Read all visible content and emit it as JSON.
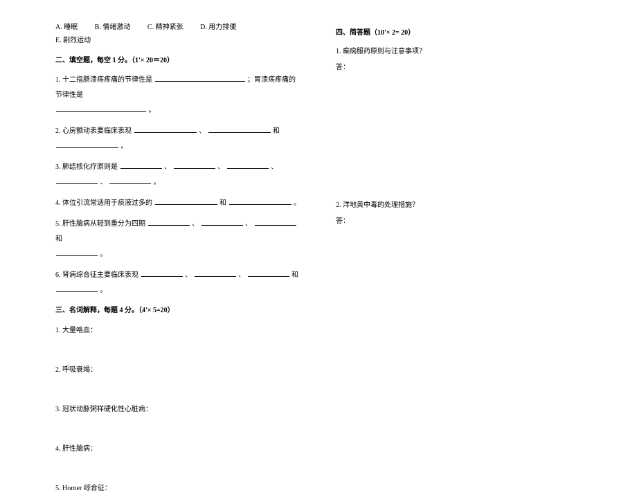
{
  "leftColumn": {
    "options": {
      "a": "A. 睡眠",
      "b": "B. 情绪激动",
      "c": "C. 精神紧张",
      "d": "D. 用力排便",
      "e": "E. 剧烈运动"
    },
    "secHeading2": "二、填空题，每空 1 分。（1'× 20＝20）",
    "fill": {
      "q1_pre": "1. 十二指肠溃疡疼痛的节律性是",
      "q1_mid": "；胃溃疡疼痛的节律性是",
      "q1_end": "。",
      "q2_pre": "2. 心房颤动表要临床表现",
      "q2_sep1": "、",
      "q2_sep2": "和",
      "q2_end": "。",
      "q3_pre": "3. 肺结核化疗原则是",
      "q3_sep": "、",
      "q3_end": "。",
      "q4_pre": "4. 体位引流常适用于痰液过多的",
      "q4_sep": "和",
      "q4_end": "。",
      "q5_pre": "5. 肝性脑病从轻到重分为四期",
      "q5_sep": "、",
      "q5_sep_and": "和",
      "q5_end": "。",
      "q6_pre": "6. 肾病综合征主要临床表现",
      "q6_sep": "、",
      "q6_sep_and": "和",
      "q6_end": "。"
    },
    "secHeading3": "三、名词解释，每题 4 分。（4'× 5=20）",
    "terms": {
      "t1": "1. 大量咯血：",
      "t2": "2. 呼吸衰竭：",
      "t3": "3. 冠状动脉粥样硬化性心脏病：",
      "t4": "4. 肝性脑病：",
      "t5": "5. Horner 综合征："
    }
  },
  "rightColumn": {
    "secHeading4": "四、简答题（10'× 2= 20）",
    "q1": "1. 癫痫服药原则与注意事项？",
    "ansLabel": "答：",
    "q2": "2. 洋地黄中毒的处理措施？"
  }
}
